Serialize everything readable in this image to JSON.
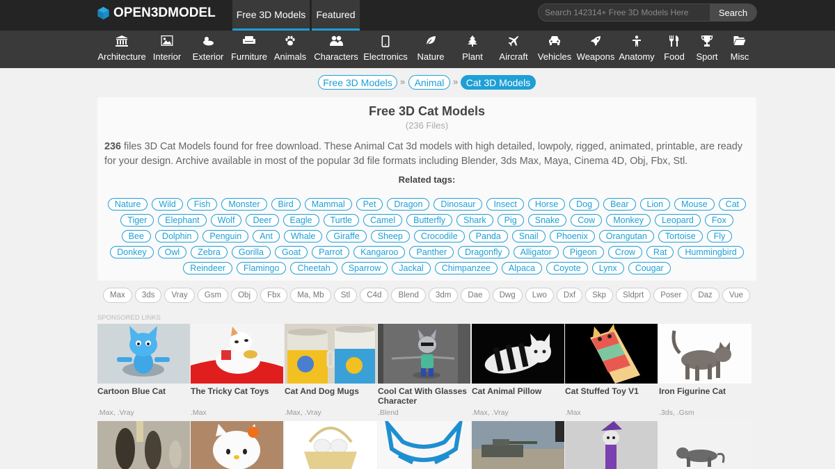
{
  "header": {
    "logo": "OPEN3DMODEL",
    "tabs": [
      {
        "label": "Free 3D Models"
      },
      {
        "label": "Featured"
      }
    ],
    "search": {
      "placeholder": "Search 142314+ Free 3D Models Here",
      "button": "Search"
    }
  },
  "categories": [
    {
      "label": "Architecture",
      "icon": "building-icon"
    },
    {
      "label": "Interior",
      "icon": "picture-icon"
    },
    {
      "label": "Exterior",
      "icon": "weather-icon"
    },
    {
      "label": "Furniture",
      "icon": "couch-icon"
    },
    {
      "label": "Animals",
      "icon": "paw-icon"
    },
    {
      "label": "Characters",
      "icon": "people-icon"
    },
    {
      "label": "Electronics",
      "icon": "phone-icon"
    },
    {
      "label": "Nature",
      "icon": "leaf-icon"
    },
    {
      "label": "Plant",
      "icon": "tree-icon"
    },
    {
      "label": "Aircraft",
      "icon": "plane-icon"
    },
    {
      "label": "Vehicles",
      "icon": "car-icon"
    },
    {
      "label": "Weapons",
      "icon": "rocket-icon"
    },
    {
      "label": "Anatomy",
      "icon": "anatomy-icon"
    },
    {
      "label": "Food",
      "icon": "utensils-icon"
    },
    {
      "label": "Sport",
      "icon": "trophy-icon"
    },
    {
      "label": "Misc",
      "icon": "folder-icon"
    }
  ],
  "breadcrumb": [
    "Free 3D Models",
    "Animal",
    "Cat 3D Models"
  ],
  "info": {
    "title": "Free 3D Cat Models",
    "files": "(236 Files)",
    "count": "236",
    "description": "files 3D Cat Models found for free download. These Animal Cat 3d models with high detailed, lowpoly, rigged, animated, printable, are ready for your design. Archive available in most of the popular 3d file formats including Blender, 3ds Max, Maya, Cinema 4D, Obj, Fbx, Stl.",
    "related_label": "Related tags:"
  },
  "tag_rows": [
    [
      "Nature",
      "Wild",
      "Fish",
      "Monster",
      "Bird",
      "Mammal",
      "Pet",
      "Dragon",
      "Dinosaur",
      "Insect",
      "Horse",
      "Dog",
      "Bear",
      "Lion",
      "Mouse",
      "Cat"
    ],
    [
      "Tiger",
      "Elephant",
      "Wolf",
      "Deer",
      "Eagle",
      "Turtle",
      "Camel",
      "Butterfly",
      "Shark",
      "Pig",
      "Snake",
      "Cow",
      "Monkey",
      "Leopard",
      "Fox"
    ],
    [
      "Bee",
      "Dolphin",
      "Penguin",
      "Ant",
      "Whale",
      "Giraffe",
      "Sheep",
      "Crocodile",
      "Panda",
      "Snail",
      "Phoenix",
      "Orangutan",
      "Tortoise",
      "Fly"
    ],
    [
      "Donkey",
      "Owl",
      "Zebra",
      "Gorilla",
      "Goat",
      "Parrot",
      "Kangaroo",
      "Panther",
      "Dragonfly",
      "Alligator",
      "Pigeon",
      "Crow",
      "Rat",
      "Hummingbird"
    ],
    [
      "Reindeer",
      "Flamingo",
      "Cheetah",
      "Sparrow",
      "Jackal",
      "Chimpanzee",
      "Alpaca",
      "Coyote",
      "Lynx",
      "Cougar"
    ]
  ],
  "formats": [
    "Max",
    "3ds",
    "Vray",
    "Gsm",
    "Obj",
    "Fbx",
    "Ma, Mb",
    "Stl",
    "C4d",
    "Blend",
    "3dm",
    "Dae",
    "Dwg",
    "Lwo",
    "Dxf",
    "Skp",
    "Sldprt",
    "Poser",
    "Daz",
    "Vue"
  ],
  "sponsored_label": "SPONSORED LINKS",
  "cards": [
    {
      "title": "Cartoon Blue Cat",
      "formats": ".Max, .Vray"
    },
    {
      "title": "The Tricky Cat Toys",
      "formats": ".Max"
    },
    {
      "title": "Cat And Dog Mugs",
      "formats": ".Max, .Vray"
    },
    {
      "title": "Cool Cat With Glasses Character",
      "formats": ".Blend"
    },
    {
      "title": "Cat Animal Pillow",
      "formats": ".Max, .Vray"
    },
    {
      "title": "Cat Stuffed Toy V1",
      "formats": ".Max"
    },
    {
      "title": "Iron Figurine Cat",
      "formats": ".3ds, .Gsm"
    }
  ],
  "colors": {
    "accent": "#1e9fd6",
    "topbar": "#242424",
    "catbar": "#3a3a3a",
    "background": "#f1f1f1"
  }
}
